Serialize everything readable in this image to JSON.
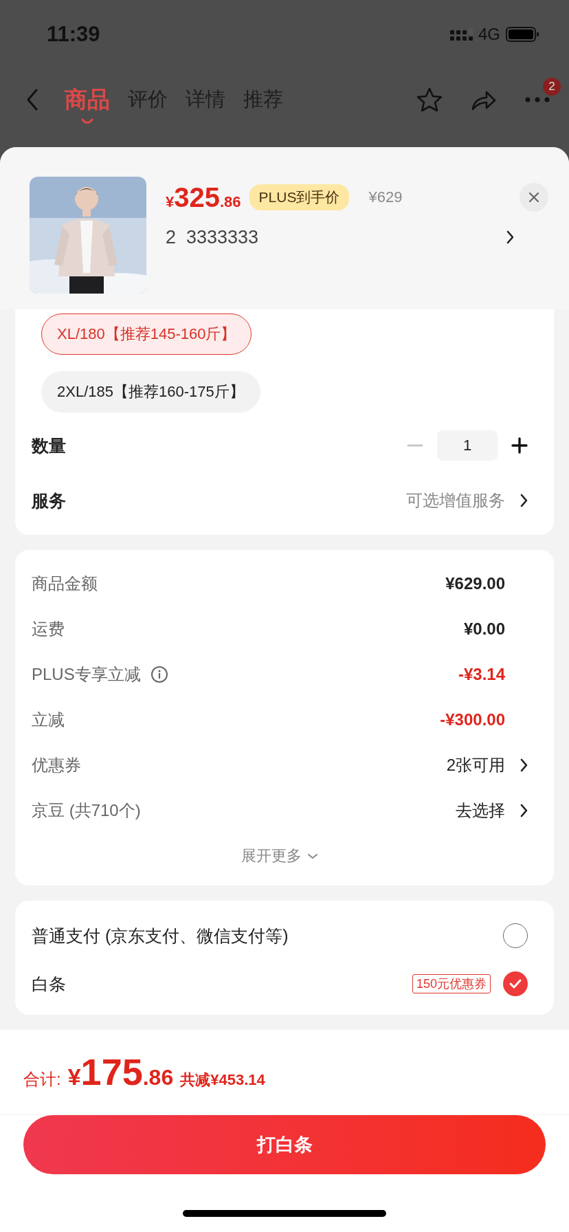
{
  "status_bar": {
    "time": "11:39",
    "network": "4G"
  },
  "nav": {
    "tabs": [
      {
        "label": "商品",
        "selected": true
      },
      {
        "label": "评价",
        "selected": false
      },
      {
        "label": "详情",
        "selected": false
      },
      {
        "label": "推荐",
        "selected": false
      }
    ],
    "badge": "2"
  },
  "product": {
    "price_symbol": "¥",
    "price_int": "325",
    "price_dec": ".86",
    "price_tag": "PLUS到手价",
    "original_price": "¥629",
    "selection": "2  3333333"
  },
  "sizes": [
    {
      "label": "XL/180【推荐145-160斤】",
      "selected": true
    },
    {
      "label": "2XL/185【推荐160-175斤】",
      "selected": false
    }
  ],
  "quantity": {
    "label": "数量",
    "value": "1",
    "decrement_disabled": true
  },
  "service": {
    "label": "服务",
    "value": "可选增值服务"
  },
  "costs": [
    {
      "label": "商品金额",
      "value": "¥629.00",
      "kind": "amount"
    },
    {
      "label": "运费",
      "value": "¥0.00",
      "kind": "amount"
    },
    {
      "label": "PLUS专享立减",
      "value": "-¥3.14",
      "kind": "discount",
      "info": true
    },
    {
      "label": "立减",
      "value": "-¥300.00",
      "kind": "discount"
    },
    {
      "label": "优惠券",
      "value": "2张可用",
      "kind": "link"
    },
    {
      "label": "京豆 (共710个)",
      "value": "去选择",
      "kind": "link"
    }
  ],
  "expand": "展开更多",
  "payments": [
    {
      "label": "普通支付 (京东支付、微信支付等)",
      "selected": false
    },
    {
      "label": "白条",
      "tag": "150元优惠券",
      "selected": true
    }
  ],
  "total": {
    "label": "合计:",
    "symbol": "¥",
    "int": "175",
    "dec": ".86",
    "saving": "共减¥453.14"
  },
  "submit": "打白条"
}
